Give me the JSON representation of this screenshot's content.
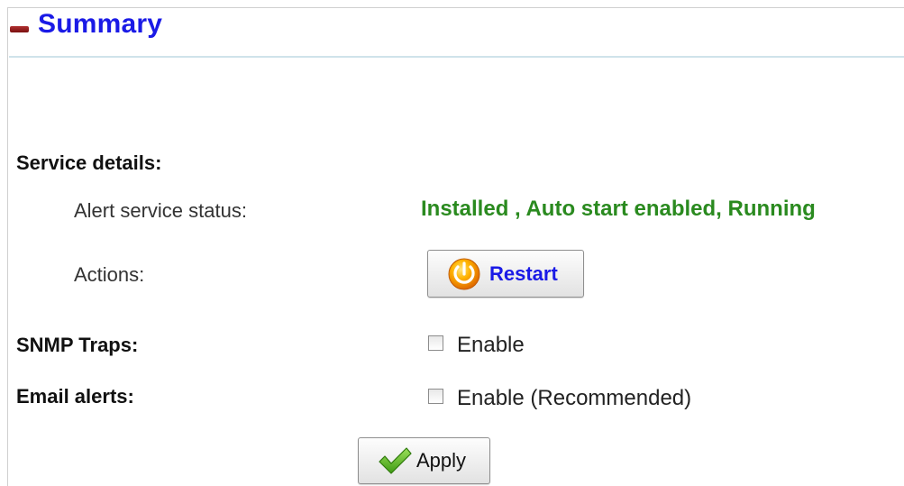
{
  "header": {
    "title": "Summary",
    "collapse_icon": "collapse-minus-icon"
  },
  "service": {
    "heading": "Service details:",
    "status_label": "Alert service status:",
    "status_value": "Installed , Auto start enabled, Running",
    "status_color": "#2a8a1f",
    "actions_label": "Actions:",
    "restart_label": "Restart",
    "restart_icon": "restart-power-icon"
  },
  "snmp": {
    "label": "SNMP Traps:",
    "checkbox_label": "Enable",
    "checked": false
  },
  "email": {
    "label": "Email alerts:",
    "checkbox_label": "Enable (Recommended)",
    "checked": false
  },
  "footer": {
    "apply_label": "Apply",
    "apply_icon": "checkmark-icon"
  },
  "colors": {
    "title_blue": "#1a1ae6",
    "rule": "#cfe3ea",
    "collapse_red": "#9a1f1f"
  }
}
